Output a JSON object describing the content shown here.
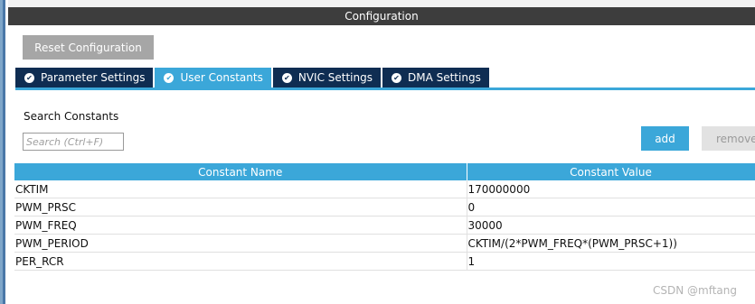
{
  "panel": {
    "title": "Configuration"
  },
  "toolbar": {
    "reset_label": "Reset Configuration"
  },
  "tabs": [
    {
      "label": "Parameter Settings",
      "active": false
    },
    {
      "label": "User Constants",
      "active": true
    },
    {
      "label": "NVIC Settings",
      "active": false
    },
    {
      "label": "DMA Settings",
      "active": false
    }
  ],
  "search": {
    "label": "Search Constants",
    "placeholder": "Search (Ctrl+F)"
  },
  "buttons": {
    "add": "add",
    "remove": "remove"
  },
  "table": {
    "headers": [
      "Constant Name",
      "Constant Value"
    ],
    "rows": [
      [
        "CKTIM",
        "170000000"
      ],
      [
        "PWM_PRSC",
        "0"
      ],
      [
        "PWM_FREQ",
        "30000"
      ],
      [
        "PWM_PERIOD",
        "CKTIM/(2*PWM_FREQ*(PWM_PRSC+1))"
      ],
      [
        "PER_RCR",
        "1"
      ]
    ]
  },
  "watermark": "CSDN @mftang",
  "colors": {
    "accent": "#3ba7d9",
    "tab_inactive": "#0f2d52",
    "title_bar": "#3d3d3d",
    "button_gray": "#a6a6a6"
  },
  "icons": {
    "tab_status": "check-circle-icon"
  }
}
